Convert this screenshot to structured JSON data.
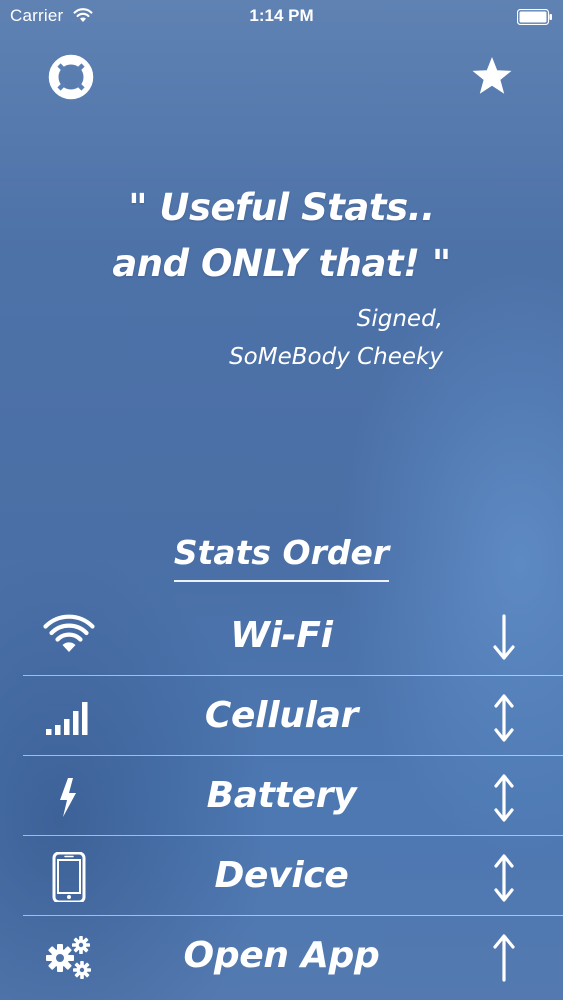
{
  "status_bar": {
    "carrier": "Carrier",
    "time": "1:14 PM"
  },
  "header": {
    "left_icon": "lifebuoy-icon",
    "right_icon": "star-icon"
  },
  "quote": {
    "line1": "\" Useful Stats..",
    "line2": "and ONLY that! \"",
    "signature_line1": "Signed,",
    "signature_line2": "SoMeBody Cheeky"
  },
  "stats_order": {
    "title": "Stats Order",
    "items": [
      {
        "label": "Wi-Fi",
        "icon": "wifi-icon",
        "arrow": "arrow-down-icon"
      },
      {
        "label": "Cellular",
        "icon": "cellular-signal-icon",
        "arrow": "arrow-up-down-icon"
      },
      {
        "label": "Battery",
        "icon": "lightning-bolt-icon",
        "arrow": "arrow-up-down-icon"
      },
      {
        "label": "Device",
        "icon": "phone-device-icon",
        "arrow": "arrow-up-down-icon"
      },
      {
        "label": "Open App",
        "icon": "gears-icon",
        "arrow": "arrow-up-icon"
      }
    ]
  },
  "colors": {
    "background": "#4d72a8",
    "text": "#ffffff",
    "divider": "#a9bedb"
  }
}
